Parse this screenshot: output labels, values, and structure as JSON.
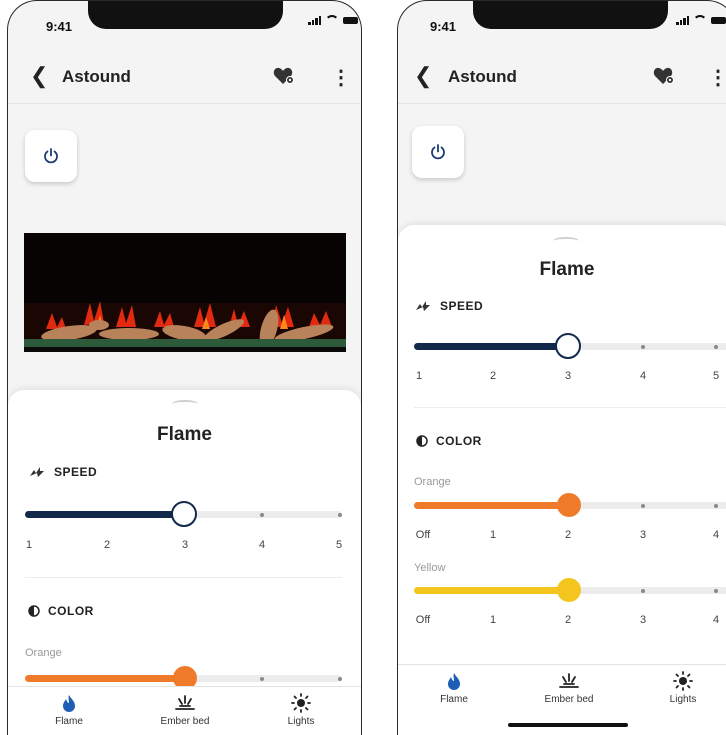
{
  "status": {
    "time": "9:41"
  },
  "header": {
    "title": "Astound"
  },
  "panel": {
    "title": "Flame",
    "speed": {
      "label": "SPEED",
      "value": 3,
      "ticks": [
        "1",
        "2",
        "3",
        "4",
        "5"
      ]
    },
    "color": {
      "label": "COLOR",
      "orange": {
        "label": "Orange",
        "value": 2,
        "ticks": [
          "Off",
          "1",
          "2",
          "3",
          "4"
        ]
      },
      "yellow": {
        "label": "Yellow",
        "value": 2,
        "ticks": [
          "Off",
          "1",
          "2",
          "3",
          "4"
        ]
      }
    }
  },
  "tabs": {
    "flame": "Flame",
    "ember": "Ember bed",
    "lights": "Lights"
  },
  "colors": {
    "speed": "#12294a",
    "orange": "#ef7b2a",
    "yellow": "#f4c51d",
    "flame_tab": "#1e5fb5"
  }
}
